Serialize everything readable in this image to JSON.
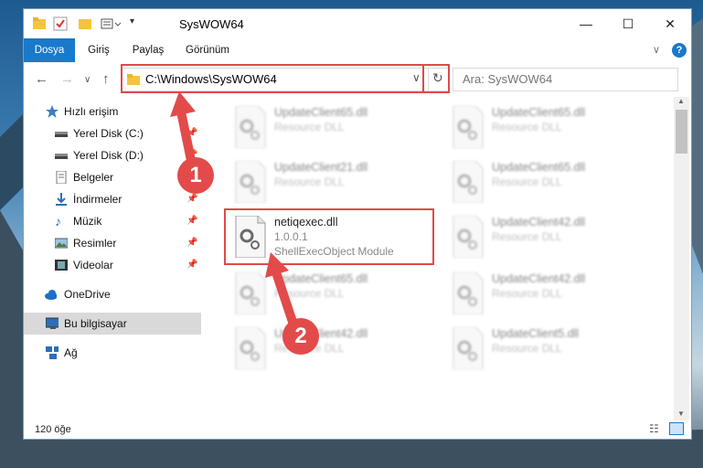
{
  "window": {
    "title": "SysWOW64"
  },
  "ribbon": {
    "tabs": [
      {
        "label": "Dosya"
      },
      {
        "label": "Giriş"
      },
      {
        "label": "Paylaş"
      },
      {
        "label": "Görünüm"
      }
    ]
  },
  "address": {
    "path": "C:\\Windows\\SysWOW64"
  },
  "search": {
    "placeholder": "Ara: SysWOW64"
  },
  "sidebar": {
    "items": [
      {
        "label": "Hızlı erişim"
      },
      {
        "label": "Yerel Disk (C:)"
      },
      {
        "label": "Yerel Disk (D:)"
      },
      {
        "label": "Belgeler"
      },
      {
        "label": "İndirmeler"
      },
      {
        "label": "Müzik"
      },
      {
        "label": "Resimler"
      },
      {
        "label": "Videolar"
      },
      {
        "label": "OneDrive"
      },
      {
        "label": "Bu bilgisayar"
      },
      {
        "label": "Ağ"
      }
    ]
  },
  "files": {
    "left": [
      {
        "name": "UpdateClient65.dll",
        "desc": "Resource DLL"
      },
      {
        "name": "UpdateClient21.dll",
        "desc": "Resource DLL"
      },
      {
        "name": "netiqexec.dll",
        "version": "1.0.0.1",
        "desc": "ShellExecObject Module"
      },
      {
        "name": "UpdateClient65.dll",
        "desc": "Resource DLL"
      },
      {
        "name": "UpdateClient42.dll",
        "desc": "Resource DLL"
      }
    ],
    "right": [
      {
        "name": "UpdateClient65.dll",
        "desc": "Resource DLL"
      },
      {
        "name": "UpdateClient65.dll",
        "desc": "Resource DLL"
      },
      {
        "name": "UpdateClient42.dll",
        "desc": "Resource DLL"
      },
      {
        "name": "UpdateClient42.dll",
        "desc": "Resource DLL"
      },
      {
        "name": "UpdateClient5.dll",
        "desc": "Resource DLL"
      }
    ]
  },
  "status": {
    "count": "120 öğe"
  },
  "callouts": {
    "one": "1",
    "two": "2"
  },
  "colors": {
    "accent": "#1979ca",
    "highlight": "#e04a4a"
  }
}
